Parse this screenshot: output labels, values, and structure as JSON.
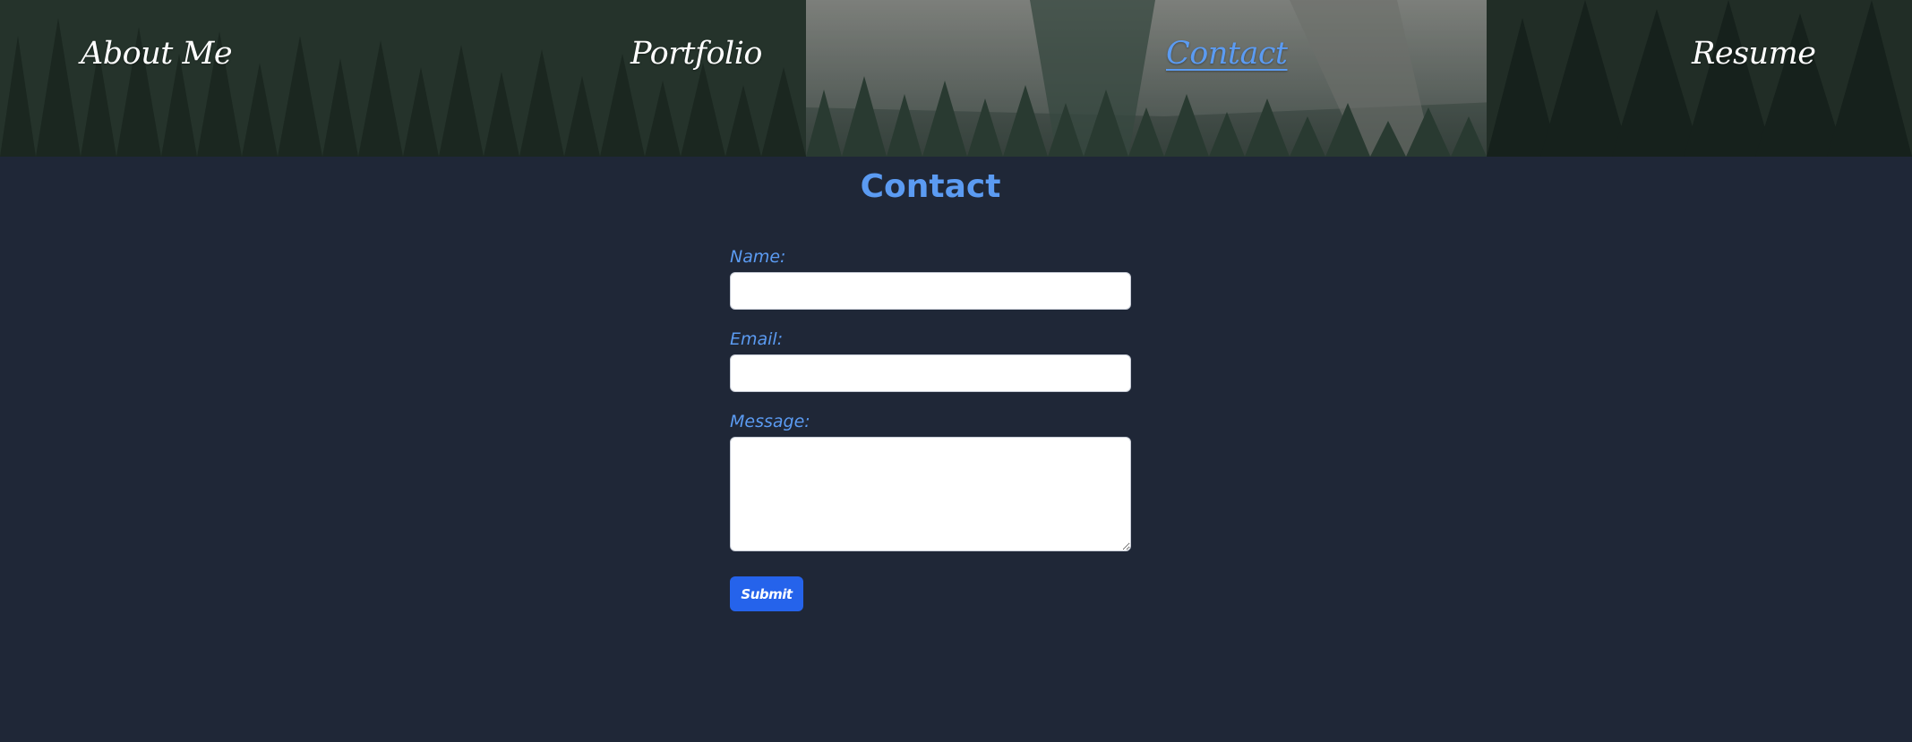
{
  "nav": {
    "items": [
      {
        "label": "About Me",
        "active": false
      },
      {
        "label": "Portfolio",
        "active": false
      },
      {
        "label": "Contact",
        "active": true
      },
      {
        "label": "Resume",
        "active": false
      }
    ]
  },
  "page": {
    "title": "Contact"
  },
  "form": {
    "name_label": "Name:",
    "name_value": "",
    "email_label": "Email:",
    "email_value": "",
    "message_label": "Message:",
    "message_value": "",
    "submit_label": "Submit"
  },
  "colors": {
    "background": "#1f2737",
    "accent": "#5b9bf2",
    "button": "#2563eb",
    "nav_text": "#ffffff"
  }
}
